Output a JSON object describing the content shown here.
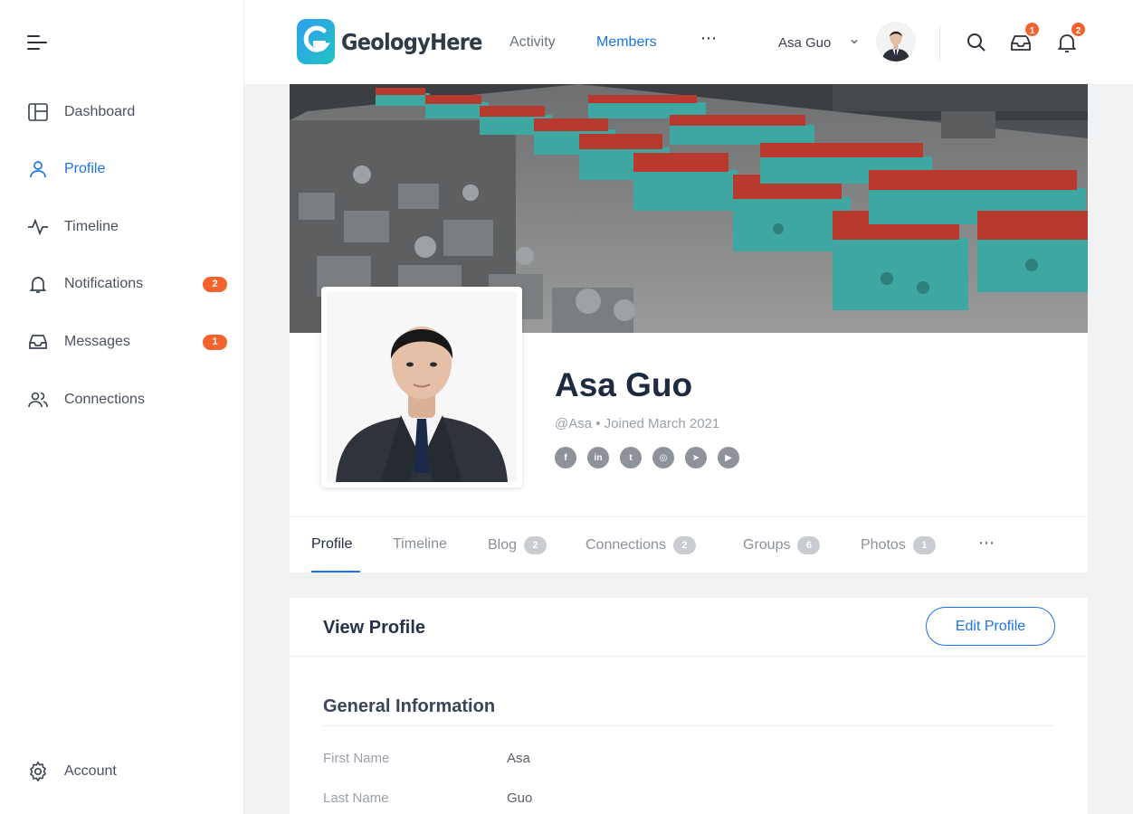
{
  "sidebar": {
    "items": [
      {
        "label": "Dashboard",
        "icon": "dashboard-icon"
      },
      {
        "label": "Profile",
        "icon": "user-icon",
        "active": true
      },
      {
        "label": "Timeline",
        "icon": "activity-icon"
      },
      {
        "label": "Notifications",
        "icon": "bell-icon",
        "badge": "2"
      },
      {
        "label": "Messages",
        "icon": "inbox-icon",
        "badge": "1"
      },
      {
        "label": "Connections",
        "icon": "users-icon"
      }
    ],
    "account_label": "Account",
    "account_icon": "gear-icon"
  },
  "header": {
    "brand": "GeologyHere",
    "nav": {
      "activity": "Activity",
      "members": "Members",
      "more": "⋯"
    },
    "user_name": "Asa Guo",
    "messages_badge": "1",
    "notifications_badge": "2"
  },
  "profile": {
    "name": "Asa Guo",
    "meta": "@Asa • Joined March 2021",
    "socials": [
      {
        "icon": "facebook-icon",
        "glyph": "f"
      },
      {
        "icon": "linkedin-icon",
        "glyph": "in"
      },
      {
        "icon": "twitter-icon",
        "glyph": "t"
      },
      {
        "icon": "instagram-icon",
        "glyph": "◎"
      },
      {
        "icon": "telegram-icon",
        "glyph": "➤"
      },
      {
        "icon": "youtube-icon",
        "glyph": "▶"
      }
    ],
    "tabs": [
      {
        "label": "Profile",
        "active": true
      },
      {
        "label": "Timeline"
      },
      {
        "label": "Blog",
        "count": "2"
      },
      {
        "label": "Connections",
        "count": "2"
      },
      {
        "label": "Groups",
        "count": "6"
      },
      {
        "label": "Photos",
        "count": "1"
      }
    ],
    "tabs_more": "⋯"
  },
  "view_profile": {
    "title": "View Profile",
    "edit_label": "Edit Profile",
    "section": "General Information",
    "fields": [
      {
        "label": "First Name",
        "value": "Asa"
      },
      {
        "label": "Last Name",
        "value": "Guo"
      }
    ]
  },
  "colors": {
    "accent": "#1d73e8",
    "badge": "#f4622d",
    "machine_teal": "#3fa7a1",
    "machine_red": "#b8392e"
  }
}
